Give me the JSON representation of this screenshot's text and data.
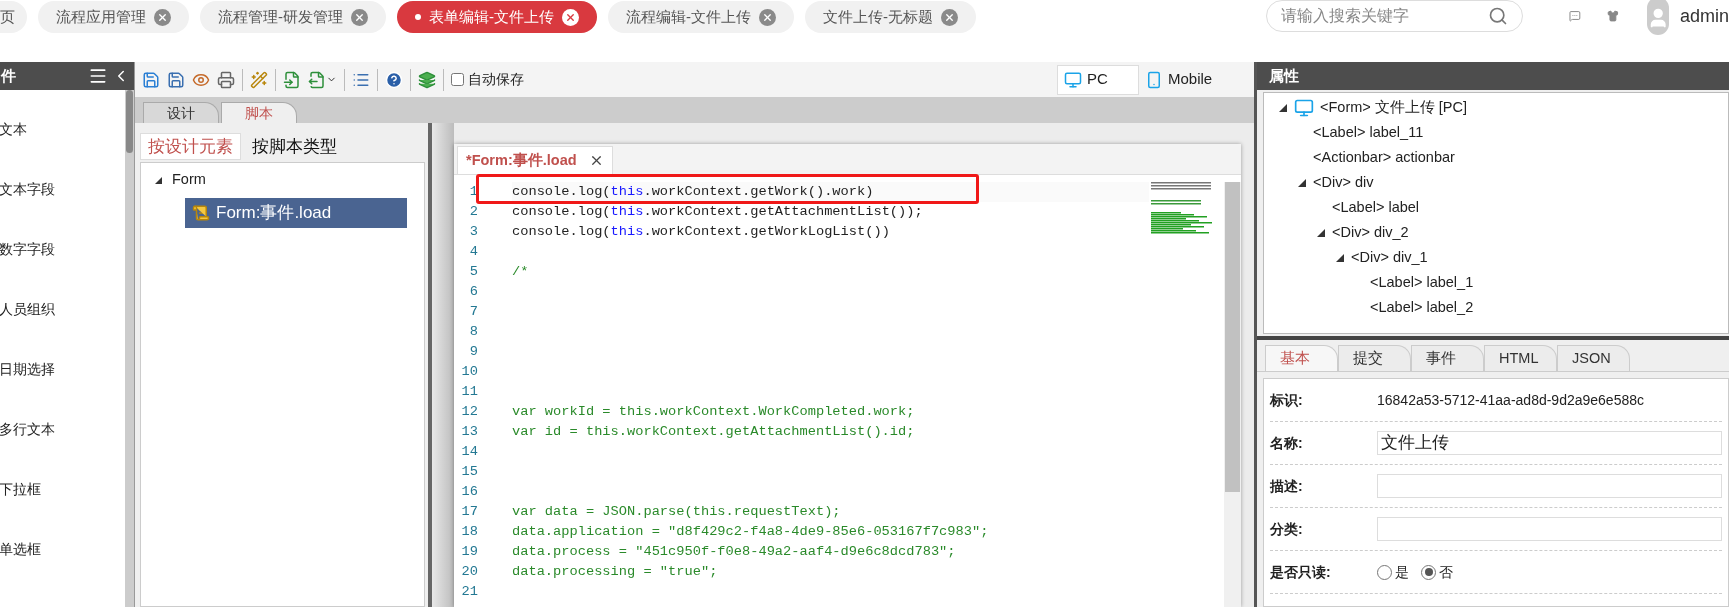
{
  "top_tabs": [
    {
      "label": "页",
      "selected": false,
      "closable": false
    },
    {
      "label": "流程应用管理",
      "selected": false,
      "closable": true
    },
    {
      "label": "流程管理-研发管理",
      "selected": false,
      "closable": true
    },
    {
      "label": "表单编辑-文件上传",
      "selected": true,
      "closable": true
    },
    {
      "label": "流程编辑-文件上传",
      "selected": false,
      "closable": true
    },
    {
      "label": "文件上传-无标题",
      "selected": false,
      "closable": true
    }
  ],
  "search": {
    "placeholder": "请输入搜索关键字"
  },
  "user": {
    "name": "admin"
  },
  "left_panel": {
    "title": "件",
    "items": [
      "文本",
      "文本字段",
      "数字字段",
      "人员组织",
      "日期选择",
      "多行文本",
      "下拉框",
      "单选框"
    ]
  },
  "toolbar": {
    "autosave": {
      "label": "自动保存",
      "checked": false
    },
    "views": [
      {
        "label": "PC",
        "selected": true
      },
      {
        "label": "Mobile",
        "selected": false
      }
    ]
  },
  "mode_tabs": [
    {
      "label": "设计",
      "selected": false
    },
    {
      "label": "脚本",
      "selected": true
    }
  ],
  "script_filters": [
    {
      "label": "按设计元素",
      "selected": true
    },
    {
      "label": "按脚本类型",
      "selected": false
    }
  ],
  "script_tree": [
    {
      "label": "Form",
      "expanded": true,
      "selected": false,
      "children": [
        {
          "label": "Form:事件.load",
          "selected": true
        }
      ]
    }
  ],
  "editor": {
    "tab": "*Form:事件.load",
    "lines": [
      {
        "number": "1",
        "segments": [
          {
            "kind": "plain",
            "text": "console.log("
          },
          {
            "kind": "keyword",
            "text": "this"
          },
          {
            "kind": "plain",
            "text": ".workContext.getWork().work)"
          }
        ]
      },
      {
        "number": "2",
        "segments": [
          {
            "kind": "plain",
            "text": "console.log("
          },
          {
            "kind": "keyword",
            "text": "this"
          },
          {
            "kind": "plain",
            "text": ".workContext.getAttachmentList());"
          }
        ]
      },
      {
        "number": "3",
        "segments": [
          {
            "kind": "plain",
            "text": "console.log("
          },
          {
            "kind": "keyword",
            "text": "this"
          },
          {
            "kind": "plain",
            "text": ".workContext.getWorkLogList())"
          }
        ]
      },
      {
        "number": "4"
      },
      {
        "number": "5",
        "segments": [
          {
            "kind": "comment",
            "text": "/*"
          }
        ]
      },
      {
        "number": "6"
      },
      {
        "number": "7"
      },
      {
        "number": "8"
      },
      {
        "number": "9"
      },
      {
        "number": "10"
      },
      {
        "number": "11"
      },
      {
        "number": "12",
        "segments": [
          {
            "kind": "comment",
            "text": "var workId = this.workContext.WorkCompleted.work;"
          }
        ]
      },
      {
        "number": "13",
        "segments": [
          {
            "kind": "comment",
            "text": "var id = this.workContext.getAttachmentList().id;"
          }
        ]
      },
      {
        "number": "14"
      },
      {
        "number": "15"
      },
      {
        "number": "16"
      },
      {
        "number": "17",
        "segments": [
          {
            "kind": "comment",
            "text": "var data = JSON.parse(this.requestText);"
          }
        ]
      },
      {
        "number": "18",
        "segments": [
          {
            "kind": "comment",
            "text": "data.application = \"d8f429c2-f4a8-4de9-85e6-053167f7c983\";"
          }
        ]
      },
      {
        "number": "19",
        "segments": [
          {
            "kind": "comment",
            "text": "data.process = \"451c950f-f0e8-49a2-aaf4-d9e6c8dcd783\";"
          }
        ]
      },
      {
        "number": "20",
        "segments": [
          {
            "kind": "comment",
            "text": "data.processing = \"true\";"
          }
        ]
      },
      {
        "number": "21"
      }
    ]
  },
  "properties": {
    "title": "属性",
    "tree": [
      {
        "label": "<Form> 文件上传 [PC]",
        "expanded": true,
        "children": [
          {
            "label": "<Label> label_11"
          },
          {
            "label": "<Actionbar> actionbar"
          },
          {
            "label": "<Div> div",
            "expanded": true,
            "children": [
              {
                "label": "<Label> label"
              },
              {
                "label": "<Div> div_2",
                "expanded": true,
                "children": [
                  {
                    "label": "<Div> div_1",
                    "expanded": true,
                    "children": [
                      {
                        "label": "<Label> label_1"
                      },
                      {
                        "label": "<Label> label_2"
                      }
                    ]
                  }
                ]
              }
            ]
          }
        ]
      }
    ],
    "tabs": [
      {
        "label": "基本",
        "selected": true
      },
      {
        "label": "提交",
        "selected": false
      },
      {
        "label": "事件",
        "selected": false
      },
      {
        "label": "HTML",
        "selected": false
      },
      {
        "label": "JSON",
        "selected": false
      }
    ],
    "fields": [
      {
        "kind": "text",
        "label": "标识:",
        "value": "16842a53-5712-41aa-ad8d-9d2a9e6e588c"
      },
      {
        "kind": "input",
        "label": "名称:",
        "value": "文件上传"
      },
      {
        "kind": "input",
        "label": "描述:"
      },
      {
        "kind": "input",
        "label": "分类:"
      },
      {
        "kind": "radio",
        "label": "是否只读:",
        "options": [
          {
            "label": "是",
            "selected": false
          },
          {
            "label": "否",
            "selected": true
          }
        ]
      }
    ]
  }
}
